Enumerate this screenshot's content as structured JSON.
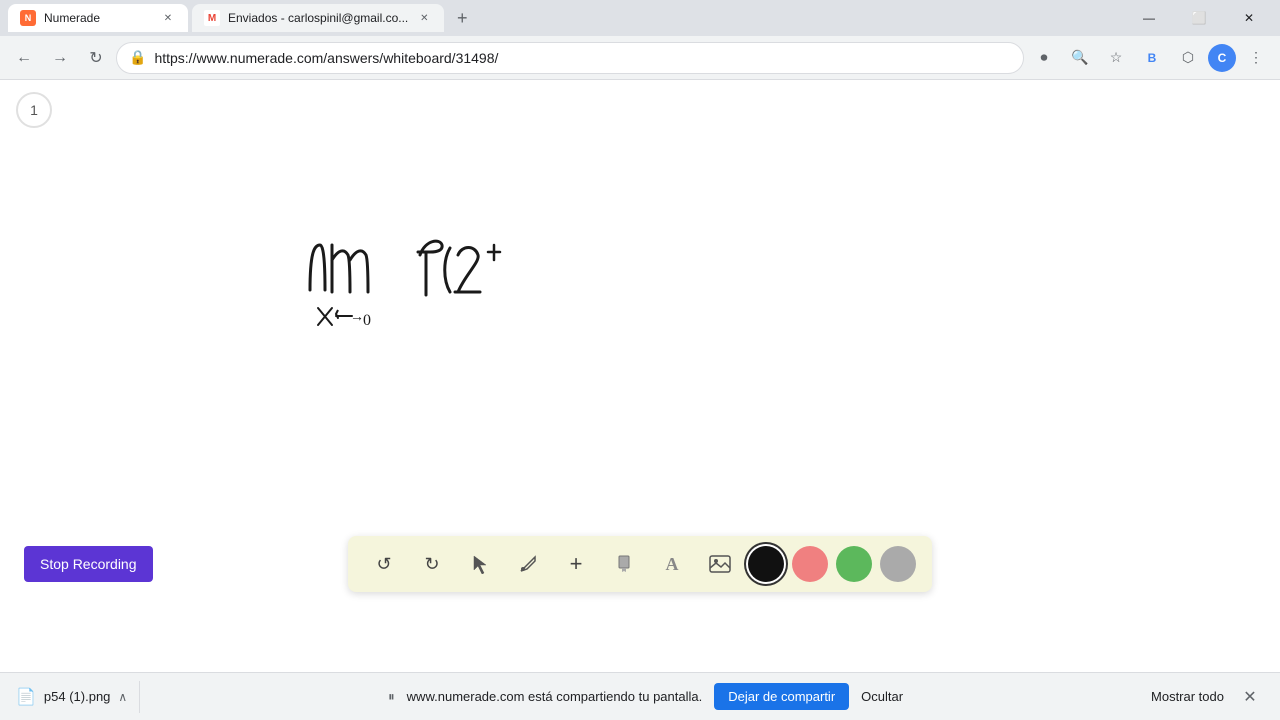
{
  "browser": {
    "tabs": [
      {
        "id": "numerade",
        "label": "Numerade",
        "favicon_type": "numerade",
        "active": true
      },
      {
        "id": "gmail",
        "label": "Enviados - carlospinil@gmail.co...",
        "favicon_type": "gmail",
        "active": false
      }
    ],
    "new_tab_label": "+",
    "window_controls": {
      "minimize": "—",
      "maximize": "⬜",
      "close": "✕"
    },
    "nav": {
      "back_label": "←",
      "forward_label": "→",
      "refresh_label": "↻",
      "url": "https://www.numerade.com/answers/whiteboard/31498/",
      "bookmark_icon": "☆",
      "extensions_icon": "⬡",
      "profile_initial": "C",
      "menu_icon": "⋮"
    }
  },
  "whiteboard": {
    "page_number": "1",
    "math_expression": "lim f(2+",
    "math_subscript": "x→0"
  },
  "toolbar": {
    "buttons": [
      {
        "id": "undo",
        "icon": "↺",
        "label": "Undo"
      },
      {
        "id": "redo",
        "icon": "↻",
        "label": "Redo"
      },
      {
        "id": "select",
        "icon": "⬆",
        "label": "Select"
      },
      {
        "id": "pen",
        "icon": "✏",
        "label": "Pen"
      },
      {
        "id": "add",
        "icon": "+",
        "label": "Add"
      },
      {
        "id": "highlighter",
        "icon": "⬛",
        "label": "Highlighter"
      },
      {
        "id": "text",
        "icon": "A",
        "label": "Text"
      },
      {
        "id": "image",
        "icon": "🖼",
        "label": "Image"
      }
    ],
    "colors": [
      {
        "id": "black",
        "hex": "#111111",
        "selected": true
      },
      {
        "id": "pink",
        "hex": "#f08080"
      },
      {
        "id": "green",
        "hex": "#5cb85c"
      },
      {
        "id": "gray",
        "hex": "#aaaaaa"
      }
    ]
  },
  "recording": {
    "stop_button_label": "Stop Recording"
  },
  "status_bar": {
    "download": {
      "filename": "p54 (1).png",
      "icon": "📄"
    },
    "sharing": {
      "message": "www.numerade.com está compartiendo tu pantalla.",
      "stop_button": "Dejar de compartir",
      "hide_button": "Ocultar",
      "show_all_button": "Mostrar todo"
    }
  }
}
